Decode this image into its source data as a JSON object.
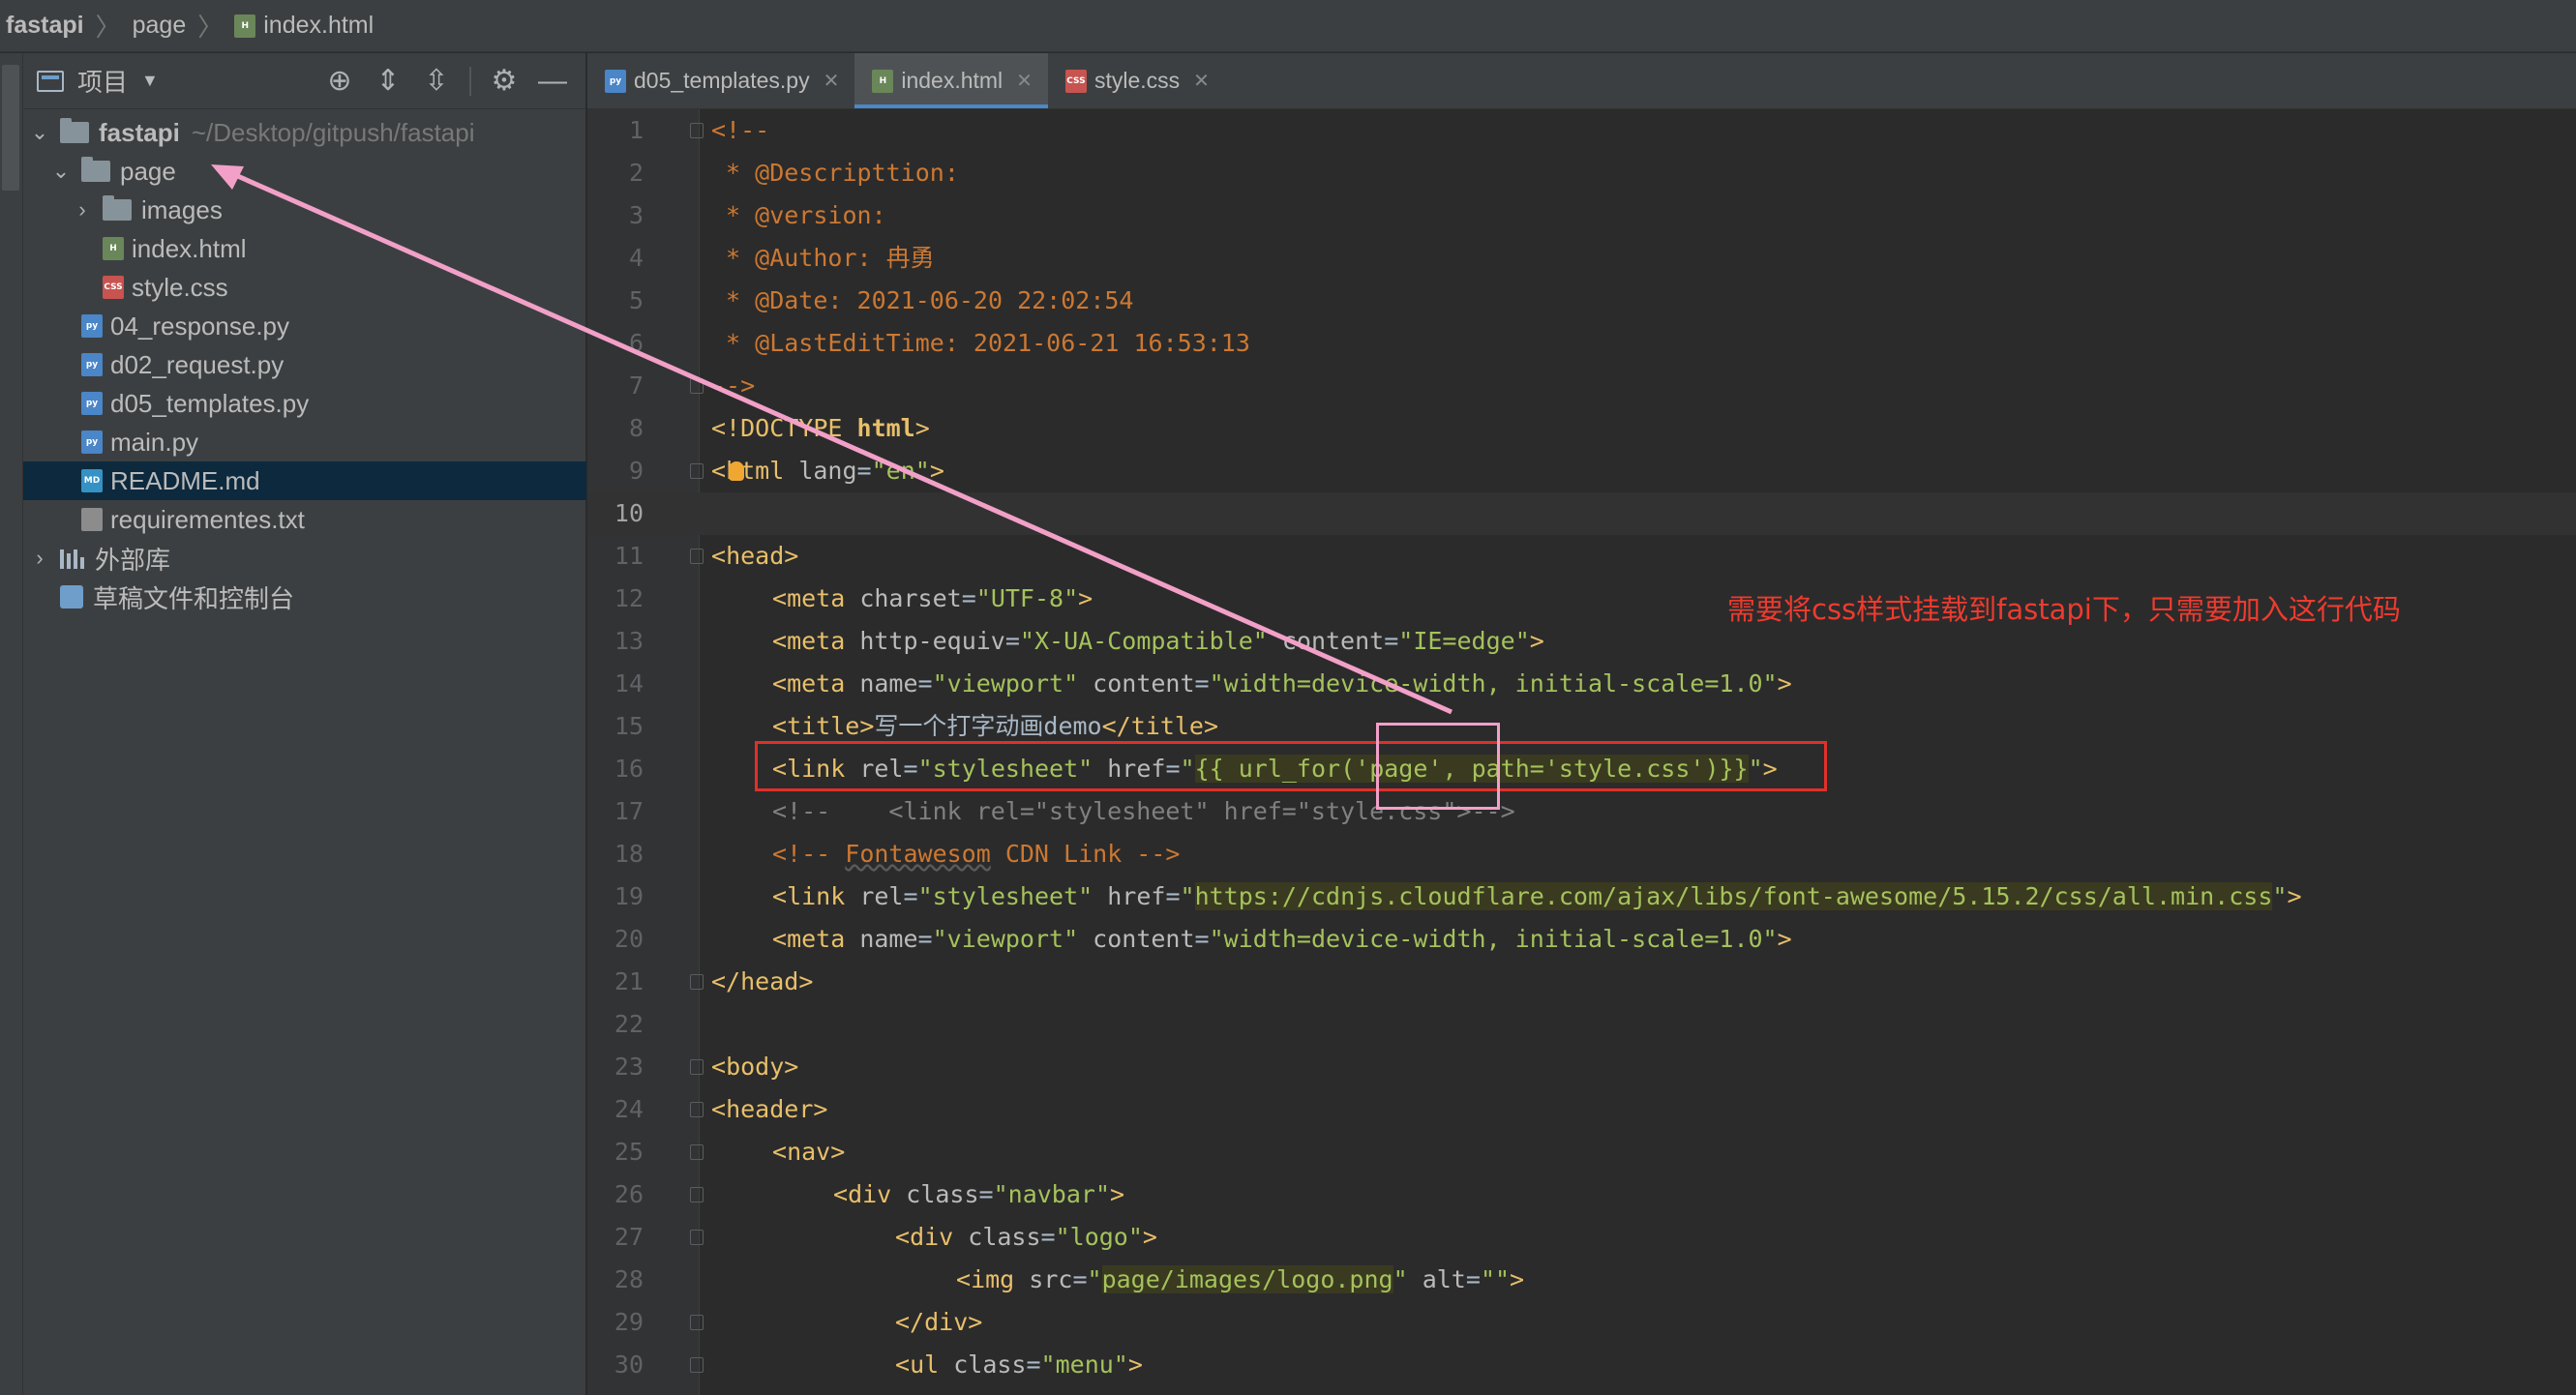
{
  "breadcrumb": {
    "project": "fastapi",
    "folder": "page",
    "file": "index.html"
  },
  "project_panel": {
    "title": "项目",
    "tools": [
      "locate-icon",
      "expand-all-icon",
      "collapse-all-icon",
      "gear-icon",
      "minimize-icon"
    ],
    "root": {
      "name": "fastapi",
      "path": "~/Desktop/gitpush/fastapi"
    },
    "items": [
      {
        "name": "page"
      },
      {
        "name": "images"
      },
      {
        "name": "index.html"
      },
      {
        "name": "style.css"
      },
      {
        "name": "04_response.py"
      },
      {
        "name": "d02_request.py"
      },
      {
        "name": "d05_templates.py"
      },
      {
        "name": "main.py"
      },
      {
        "name": "README.md"
      },
      {
        "name": "requirementes.txt"
      }
    ],
    "external_libs": "外部库",
    "scratches": "草稿文件和控制台"
  },
  "tabs": [
    {
      "label": "d05_templates.py",
      "active": false
    },
    {
      "label": "index.html",
      "active": true
    },
    {
      "label": "style.css",
      "active": false
    }
  ],
  "badges": {
    "html": "H",
    "css": "CSS",
    "py": "py",
    "md": "MD",
    "txt": ""
  },
  "editor": {
    "current_line": "10",
    "line_numbers": [
      "1",
      "2",
      "3",
      "4",
      "5",
      "6",
      "7",
      "8",
      "9",
      "10",
      "11",
      "12",
      "13",
      "14",
      "15",
      "16",
      "17",
      "18",
      "19",
      "20",
      "21",
      "22",
      "23",
      "24",
      "25",
      "26",
      "27",
      "28",
      "29",
      "30"
    ],
    "lines": {
      "l1": "<!--",
      "l2": " * @Descripttion:",
      "l3": " * @version:",
      "l4": " * @Author: 冉勇",
      "l5": " * @Date: 2021-06-20 22:02:54",
      "l6": " * @LastEditTime: 2021-06-21 16:53:13",
      "l7": "-->",
      "l8a": "<!DOCTYPE ",
      "l8b": "html",
      "l8c": ">",
      "l9a": "<",
      "l9b": "html",
      "l9c": " lang",
      "l9d": "=",
      "l9e": "\"en\"",
      "l9f": ">",
      "l11a": "<",
      "l11b": "head",
      "l11c": ">",
      "l12a": "<",
      "l12b": "meta",
      "l12c": " charset",
      "l12d": "=",
      "l12e": "\"UTF-8\"",
      "l12f": ">",
      "l13a": "<",
      "l13b": "meta",
      "l13c": " http-equiv",
      "l13d": "=",
      "l13e": "\"X-UA-Compatible\"",
      "l13f": " content",
      "l13g": "=",
      "l13h": "\"IE=edge\"",
      "l13i": ">",
      "l14a": "<",
      "l14b": "meta",
      "l14c": " name",
      "l14d": "=",
      "l14e": "\"viewport\"",
      "l14f": " content",
      "l14g": "=",
      "l14h": "\"width=device-width, initial-scale=1.0\"",
      "l14i": ">",
      "l15a": "<",
      "l15b": "title",
      "l15c": ">",
      "l15d": "写一个打字动画demo",
      "l15e": "</",
      "l15f": "title",
      "l15g": ">",
      "l16a": "<",
      "l16b": "link",
      "l16c": " rel",
      "l16d": "=",
      "l16e": "\"stylesheet\"",
      "l16f": " href",
      "l16g": "=",
      "l16h": "\"",
      "l16i": "{{ url_for(",
      "l16j": "'page'",
      "l16k": ", ",
      "l16l": "path",
      "l16m": "=",
      "l16n": "'style.css'",
      "l16o": ")}}",
      "l16p": "\"",
      "l16q": ">",
      "l17": "<!--    <link rel=\"stylesheet\" href=\"style.css\">-->",
      "l18a": "<!-- ",
      "l18b": "Fontawesom",
      "l18c": " CDN Link -->",
      "l19a": "<",
      "l19b": "link",
      "l19c": " rel",
      "l19d": "=",
      "l19e": "\"stylesheet\"",
      "l19f": " href",
      "l19g": "=",
      "l19h": "\"",
      "l19i": "https://cdnjs.cloudflare.com/ajax/libs/font-awesome/5.15.2/css/all.min.css",
      "l19j": "\"",
      "l19k": ">",
      "l20a": "<",
      "l20b": "meta",
      "l20c": " name",
      "l20d": "=",
      "l20e": "\"viewport\"",
      "l20f": " content",
      "l20g": "=",
      "l20h": "\"width=device-width, initial-scale=1.0\"",
      "l20i": ">",
      "l21a": "</",
      "l21b": "head",
      "l21c": ">",
      "l23a": "<",
      "l23b": "body",
      "l23c": ">",
      "l24a": "<",
      "l24b": "header",
      "l24c": ">",
      "l25a": "<",
      "l25b": "nav",
      "l25c": ">",
      "l26a": "<",
      "l26b": "div",
      "l26c": " class",
      "l26d": "=",
      "l26e": "\"navbar\"",
      "l26f": ">",
      "l27a": "<",
      "l27b": "div",
      "l27c": " class",
      "l27d": "=",
      "l27e": "\"logo\"",
      "l27f": ">",
      "l28a": "<",
      "l28b": "img",
      "l28c": " src",
      "l28d": "=",
      "l28e": "\"",
      "l28f": "page/images/logo.png",
      "l28g": "\"",
      "l28h": " alt",
      "l28i": "=",
      "l28j": "\"\"",
      "l28k": ">",
      "l29a": "</",
      "l29b": "div",
      "l29c": ">",
      "l30a": "<",
      "l30b": "ul",
      "l30c": " class",
      "l30d": "=",
      "l30e": "\"menu\"",
      "l30f": ">"
    }
  },
  "annotation": {
    "text": "需要将css样式挂载到fastapi下，只需要加入这行代码",
    "color": "#ee3b2f"
  },
  "colors": {
    "background": "#2b2b2b",
    "panel": "#3c3f41",
    "selection": "#0d293e",
    "tag": "#e8bf6a",
    "string": "#6a8759",
    "comment": "#cc7832",
    "highlight_box": "#e0302a",
    "arrow": "#f2a0c8"
  }
}
